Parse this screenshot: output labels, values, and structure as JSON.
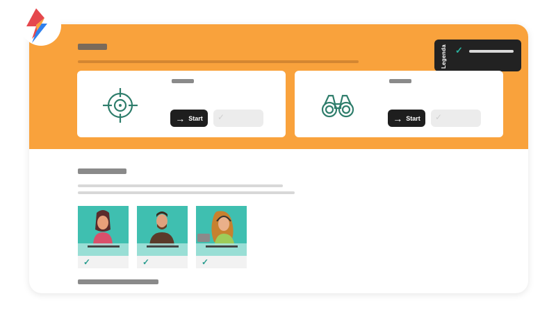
{
  "branding": {
    "logo_icon": "lightning-logo-icon"
  },
  "legend": {
    "label": "Legenda",
    "check_icon": "check-icon"
  },
  "modes": [
    {
      "icon": "target-icon",
      "start_label": "Start"
    },
    {
      "icon": "binoculars-icon",
      "start_label": "Start"
    }
  ],
  "avatars": [
    {
      "icon": "avatar-woman-icon"
    },
    {
      "icon": "avatar-man-icon"
    },
    {
      "icon": "avatar-headset-woman-icon"
    }
  ],
  "colors": {
    "hero": "#F9A23C",
    "accent_teal": "#2ab3a0",
    "button_dark": "#1e1e1e"
  }
}
